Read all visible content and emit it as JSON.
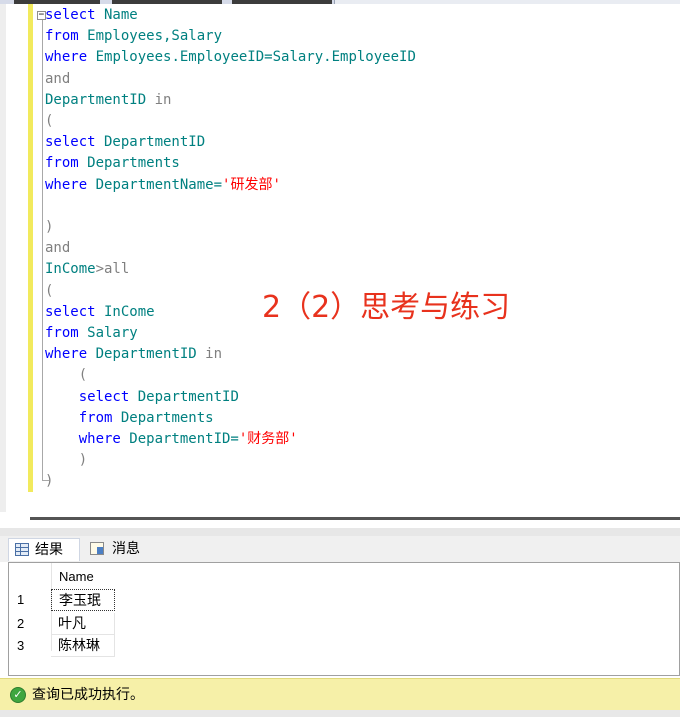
{
  "editor": {
    "lines": [
      [
        {
          "t": "select",
          "c": "kw"
        },
        {
          "t": " Name",
          "c": "id"
        }
      ],
      [
        {
          "t": "from",
          "c": "kw"
        },
        {
          "t": " Employees,Salary",
          "c": "id"
        }
      ],
      [
        {
          "t": "where",
          "c": "kw"
        },
        {
          "t": " Employees.EmployeeID=Salary.EmployeeID",
          "c": "id"
        }
      ],
      [
        {
          "t": "and",
          "c": "gray"
        }
      ],
      [
        {
          "t": "DepartmentID",
          "c": "id"
        },
        {
          "t": " in",
          "c": "gray"
        }
      ],
      [
        {
          "t": "(",
          "c": "gray"
        }
      ],
      [
        {
          "t": "select",
          "c": "kw"
        },
        {
          "t": " DepartmentID",
          "c": "id"
        }
      ],
      [
        {
          "t": "from",
          "c": "kw"
        },
        {
          "t": " Departments",
          "c": "id"
        }
      ],
      [
        {
          "t": "where",
          "c": "kw"
        },
        {
          "t": " DepartmentName=",
          "c": "id"
        },
        {
          "t": "'研发部'",
          "c": "str"
        }
      ],
      [],
      [
        {
          "t": ")",
          "c": "gray"
        }
      ],
      [
        {
          "t": "and",
          "c": "gray"
        }
      ],
      [
        {
          "t": "InCome",
          "c": "id"
        },
        {
          "t": ">all",
          "c": "gray"
        }
      ],
      [
        {
          "t": "(",
          "c": "gray"
        }
      ],
      [
        {
          "t": "select",
          "c": "kw"
        },
        {
          "t": " InCome",
          "c": "id"
        }
      ],
      [
        {
          "t": "from",
          "c": "kw"
        },
        {
          "t": " Salary",
          "c": "id"
        }
      ],
      [
        {
          "t": "where",
          "c": "kw"
        },
        {
          "t": " DepartmentID",
          "c": "id"
        },
        {
          "t": " in",
          "c": "gray"
        }
      ],
      [
        {
          "t": "    (",
          "c": "gray"
        }
      ],
      [
        {
          "t": "    select",
          "c": "kw"
        },
        {
          "t": " DepartmentID",
          "c": "id"
        }
      ],
      [
        {
          "t": "    from",
          "c": "kw"
        },
        {
          "t": " Departments",
          "c": "id"
        }
      ],
      [
        {
          "t": "    where",
          "c": "kw"
        },
        {
          "t": " DepartmentID=",
          "c": "id"
        },
        {
          "t": "'财务部'",
          "c": "str"
        }
      ],
      [
        {
          "t": "    )",
          "c": "gray"
        }
      ],
      [
        {
          "t": ")",
          "c": "gray"
        }
      ]
    ],
    "fold_symbol": "−"
  },
  "annotation": "2（2）思考与练习",
  "results_tabs": {
    "results_label": "结果",
    "messages_label": "消息"
  },
  "grid": {
    "header": "Name",
    "rows": [
      {
        "num": "1",
        "name": "李玉珉"
      },
      {
        "num": "2",
        "name": "叶凡"
      },
      {
        "num": "3",
        "name": "陈林琳"
      }
    ]
  },
  "status": {
    "text": "查询已成功执行。",
    "icon": "check-icon"
  },
  "colors": {
    "keyword": "#0000ff",
    "identifier": "#008080",
    "operator": "#808080",
    "string": "#ff0000",
    "annotation": "#e8321d",
    "status_bg": "#f6f0a8"
  }
}
